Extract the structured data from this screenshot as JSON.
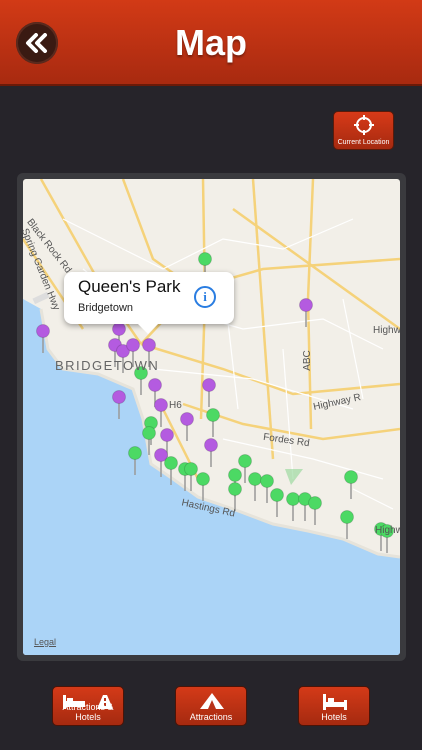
{
  "header": {
    "title": "Map"
  },
  "controls": {
    "current_location": "Current Location"
  },
  "map": {
    "labels": {
      "black_rock_rd": "Black Rock Rd",
      "spring_garden_hwy": "Spring Garden Hwy",
      "bridgetown": "BRIDGETOWN",
      "h6": "H6",
      "fordes_rd": "Fordes Rd",
      "highway_r": "Highway R",
      "abc": "ABC",
      "hastings_rd": "Hastings Rd",
      "high_right": "Highw",
      "hig_bottom": "Highw",
      "legal": "Legal"
    },
    "callout": {
      "title": "Queen's Park",
      "subtitle": "Bridgetown",
      "info": "i"
    }
  },
  "tabs": {
    "attractions_hotels": "Attractions & Hotels",
    "attractions": "Attractions",
    "hotels": "Hotels"
  },
  "colors": {
    "header": "#c8341a",
    "pin_attraction": "#b45be0",
    "pin_hotel": "#4cd964",
    "water": "#abd4f7"
  }
}
